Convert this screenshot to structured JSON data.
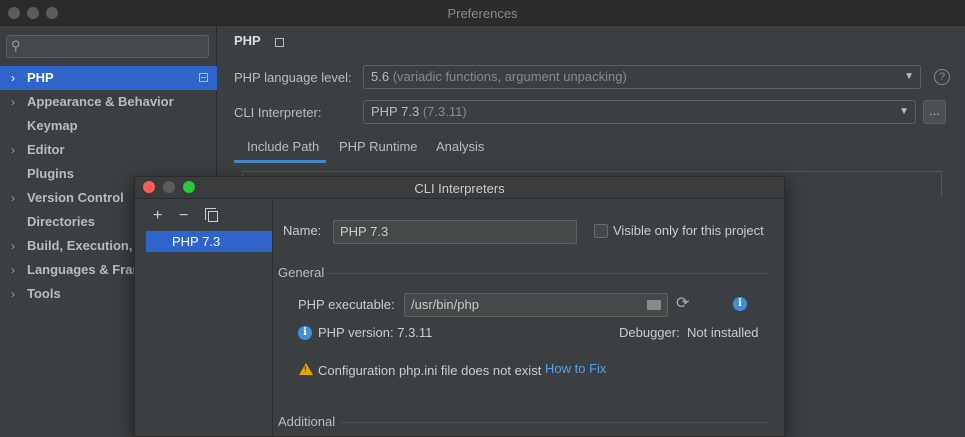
{
  "window": {
    "title": "Preferences"
  },
  "sidebar": {
    "search_placeholder": "",
    "items": [
      {
        "label": "PHP",
        "expandable": true,
        "selected": true
      },
      {
        "label": "Appearance & Behavior",
        "expandable": true
      },
      {
        "label": "Keymap",
        "expandable": false
      },
      {
        "label": "Editor",
        "expandable": true
      },
      {
        "label": "Plugins",
        "expandable": false
      },
      {
        "label": "Version Control",
        "expandable": true
      },
      {
        "label": "Directories",
        "expandable": false
      },
      {
        "label": "Build, Execution,",
        "expandable": true
      },
      {
        "label": "Languages & Frar",
        "expandable": true
      },
      {
        "label": "Tools",
        "expandable": true
      }
    ]
  },
  "main": {
    "heading": "PHP",
    "language_level_label": "PHP language level:",
    "language_level_value": "5.6",
    "language_level_hint": "(variadic functions, argument unpacking)",
    "cli_label": "CLI Interpreter:",
    "cli_value": "PHP 7.3",
    "cli_hint": "(7.3.11)",
    "more_button": "...",
    "help": "?",
    "tabs": [
      {
        "label": "Include Path",
        "active": true
      },
      {
        "label": "PHP Runtime"
      },
      {
        "label": "Analysis"
      }
    ]
  },
  "dialog": {
    "title": "CLI Interpreters",
    "toolbar": {
      "add": "+",
      "remove": "−"
    },
    "interpreters": [
      "PHP 7.3"
    ],
    "name_label": "Name:",
    "name_value": "PHP 7.3",
    "visible_only_label": "Visible only for this project",
    "general_section": "General",
    "exe_label": "PHP executable:",
    "exe_value": "/usr/bin/php",
    "php_version_text": "PHP version: 7.3.11",
    "debugger_label": "Debugger:",
    "debugger_value": "Not installed",
    "config_warning": "Configuration php.ini file does not exist",
    "how_to_fix": "How to Fix",
    "additional_section": "Additional"
  },
  "colors": {
    "accent_blue": "#2f65ca",
    "link_blue": "#5a9fe6",
    "warning_yellow": "#e5a400",
    "close_red": "#fd5f57",
    "minimize_yellow": "#5c5c5c",
    "zoom_green": "#28c840"
  },
  "icons": [
    "search-icon",
    "chevron-right-icon",
    "document-icon",
    "help-icon",
    "add-icon",
    "remove-icon",
    "copy-icon",
    "folder-icon",
    "refresh-icon",
    "info-icon",
    "warning-icon"
  ]
}
